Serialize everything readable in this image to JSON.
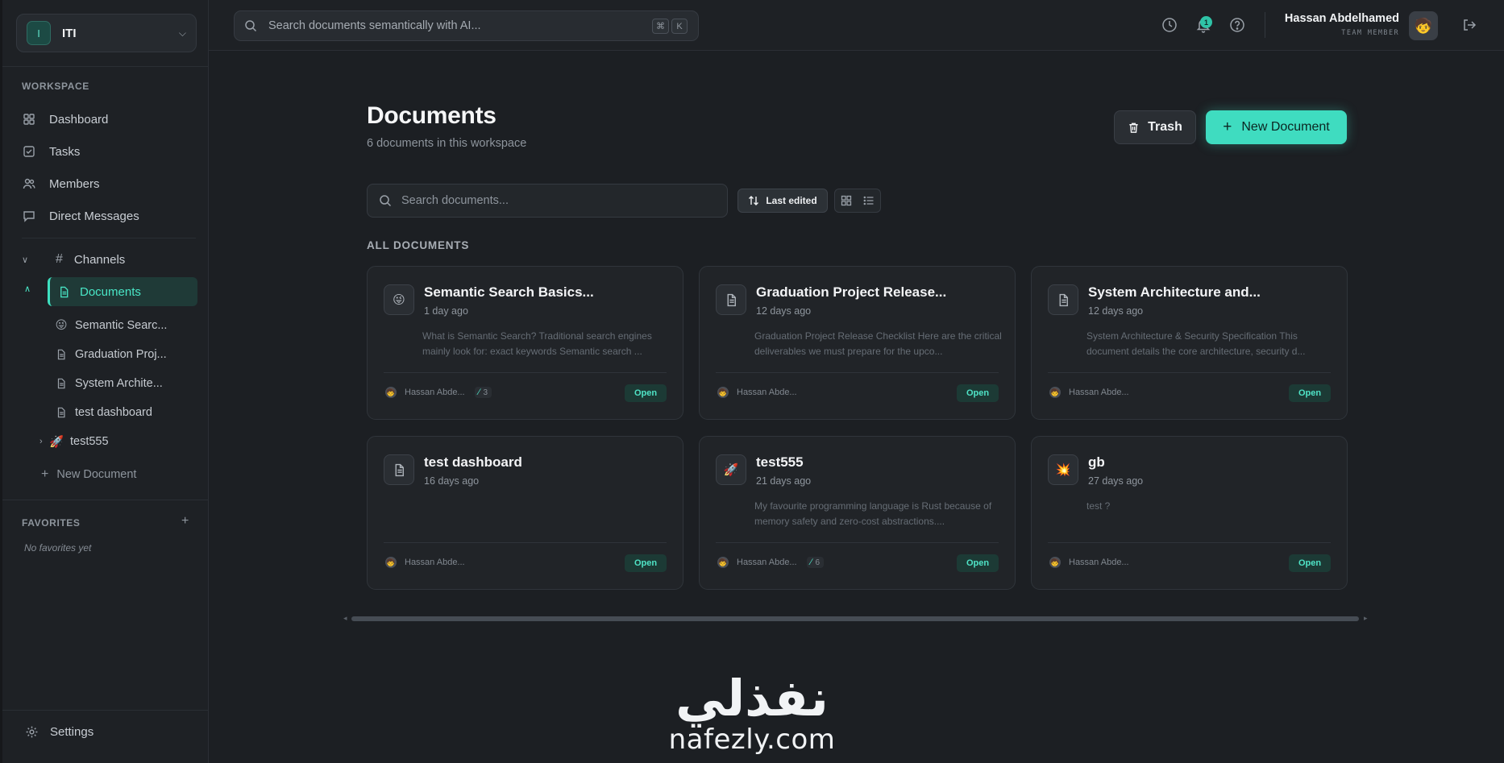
{
  "workspace": {
    "initial": "I",
    "name": "ITI"
  },
  "sidebar": {
    "workspace_label": "WORKSPACE",
    "nav": [
      {
        "label": "Dashboard",
        "icon": "grid-icon"
      },
      {
        "label": "Tasks",
        "icon": "checkbox-icon"
      },
      {
        "label": "Members",
        "icon": "users-icon"
      },
      {
        "label": "Direct Messages",
        "icon": "message-icon"
      }
    ],
    "channels_label": "Channels",
    "documents_label": "Documents",
    "doc_items": [
      {
        "label": "Semantic Searc...",
        "icon": "😜"
      },
      {
        "label": "Graduation Proj...",
        "icon": "file-icon"
      },
      {
        "label": "System Archite...",
        "icon": "file-icon"
      },
      {
        "label": "test dashboard",
        "icon": "file-icon"
      },
      {
        "label": "test555",
        "icon": "🚀"
      }
    ],
    "new_document": "New Document",
    "favorites_label": "FAVORITES",
    "no_favorites": "No favorites yet",
    "settings": "Settings"
  },
  "topbar": {
    "search_placeholder": "Search documents semantically with AI...",
    "kbd_1": "⌘",
    "kbd_2": "K",
    "notification_count": "1",
    "user_name": "Hassan Abdelhamed",
    "user_role": "TEAM MEMBER",
    "avatar": "🧒"
  },
  "main": {
    "title": "Documents",
    "subtitle": "6 documents in this workspace",
    "trash_label": "Trash",
    "new_doc_label": "New Document",
    "search_placeholder": "Search documents...",
    "sort_label": "Last edited",
    "section_label": "ALL DOCUMENTS",
    "open_label": "Open",
    "cards": [
      {
        "title": "Semantic Search Basics...",
        "time": "1 day ago",
        "icon": "😜",
        "preview": "What is Semantic Search? Traditional search engines mainly look for: exact keywords Semantic search ...",
        "author": "Hassan Abde...",
        "attachments": "3"
      },
      {
        "title": "Graduation Project Release...",
        "time": "12 days ago",
        "icon": "file-icon",
        "preview": "Graduation Project Release Checklist Here are the critical deliverables we must prepare for the upco...",
        "author": "Hassan Abde...",
        "attachments": ""
      },
      {
        "title": "System Architecture and...",
        "time": "12 days ago",
        "icon": "file-icon",
        "preview": "System Architecture & Security Specification This document details the core architecture, security d...",
        "author": "Hassan Abde...",
        "attachments": ""
      },
      {
        "title": "test dashboard",
        "time": "16 days ago",
        "icon": "file-icon",
        "preview": "",
        "author": "Hassan Abde...",
        "attachments": ""
      },
      {
        "title": "test555",
        "time": "21 days ago",
        "icon": "🚀",
        "preview": "My favourite programming language is Rust because of memory safety and zero-cost abstractions....",
        "author": "Hassan Abde...",
        "attachments": "6"
      },
      {
        "title": "gb",
        "time": "27 days ago",
        "icon": "💥",
        "preview": "test ?",
        "author": "Hassan Abde...",
        "attachments": ""
      }
    ]
  },
  "watermark": {
    "arabic": "نفذلي",
    "latin": "nafezly.com"
  },
  "colors": {
    "accent": "#3fdcc0",
    "bg": "#1c1f23",
    "card": "#212428"
  }
}
